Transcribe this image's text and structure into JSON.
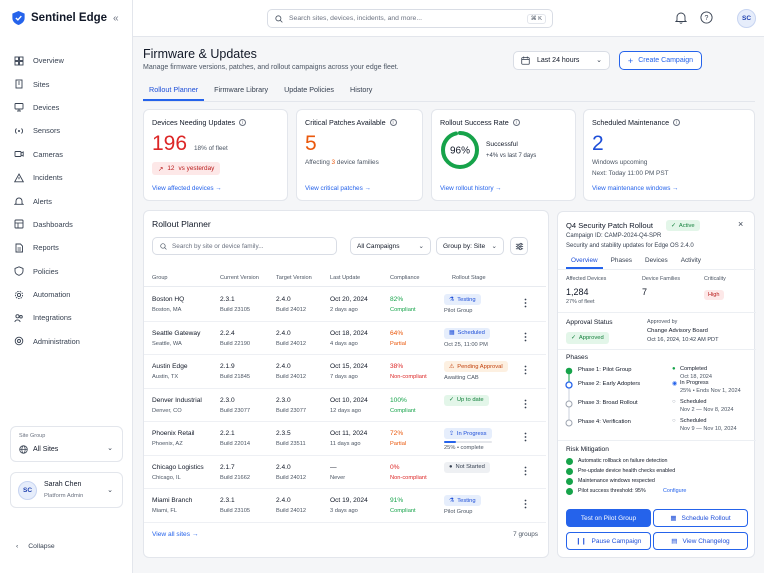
{
  "app": {
    "name": "Sentinel Edge"
  },
  "nav": [
    {
      "label": "Overview",
      "icon": "grid-icon"
    },
    {
      "label": "Sites",
      "icon": "building-icon"
    },
    {
      "label": "Devices",
      "icon": "monitor-icon"
    },
    {
      "label": "Sensors",
      "icon": "signal-icon"
    },
    {
      "label": "Cameras",
      "icon": "camera-icon"
    },
    {
      "label": "Incidents",
      "icon": "warning-icon"
    },
    {
      "label": "Alerts",
      "icon": "bell-icon"
    },
    {
      "label": "Dashboards",
      "icon": "dashboard-icon"
    },
    {
      "label": "Reports",
      "icon": "document-icon"
    },
    {
      "label": "Policies",
      "icon": "shield-icon"
    },
    {
      "label": "Automation",
      "icon": "gear-icon"
    },
    {
      "label": "Integrations",
      "icon": "people-icon"
    },
    {
      "label": "Administration",
      "icon": "settings-icon"
    }
  ],
  "site_group": {
    "label": "Site Group",
    "value": "All Sites"
  },
  "user": {
    "initials": "SC",
    "name": "Sarah Chen",
    "role": "Platform Admin"
  },
  "collapse_label": "Collapse",
  "search": {
    "placeholder": "Search sites, devices, incidents, and more...",
    "shortcut": "⌘ K"
  },
  "page": {
    "title": "Firmware & Updates",
    "subtitle": "Manage firmware versions, patches, and rollout campaigns across your edge fleet.",
    "range": "Last 24 hours",
    "create_label": "Create Campaign"
  },
  "tabs": [
    "Rollout Planner",
    "Firmware Library",
    "Update Policies",
    "History"
  ],
  "kpis": {
    "devices": {
      "title": "Devices Needing Updates",
      "value": "196",
      "pct": "18% of fleet",
      "delta": "12",
      "delta_label": "vs yesterday",
      "link": "View affected devices"
    },
    "patches": {
      "title": "Critical Patches Available",
      "value": "5",
      "desc_pre": "Affecting",
      "desc_num": "3",
      "desc_post": "device families",
      "link": "View critical patches"
    },
    "success": {
      "title": "Rollout Success Rate",
      "value": "96%",
      "progress": 0.96,
      "status": "Successful",
      "delta": "+4% vs last 7 days",
      "link": "View rollout history"
    },
    "maintenance": {
      "title": "Scheduled Maintenance",
      "value": "2",
      "desc": "Windows upcoming",
      "next": "Next: Today 11:00 PM PST",
      "link": "View maintenance windows"
    }
  },
  "planner": {
    "title": "Rollout Planner",
    "search_placeholder": "Search by site or device family...",
    "campaign_filter": "All Campaigns",
    "group_by": "Group by: Site",
    "columns": [
      "Group",
      "Current Version",
      "Target Version",
      "Last Update",
      "Compliance",
      "Rollout Stage"
    ],
    "rows": [
      {
        "name": "Boston HQ",
        "loc": "Boston, MA",
        "cur": "2.3.1",
        "cur_build": "Build 23105",
        "tgt": "2.4.0",
        "tgt_build": "Build 24012",
        "date": "Oct 20, 2024",
        "ago": "2 days ago",
        "comp": "82%",
        "comp_label": "Compliant",
        "comp_color": "#16a34a",
        "stage": "Testing",
        "stage_icon": "flask-icon",
        "stage_sub": "Pilot Group",
        "stage_bg": "#e6eefc",
        "stage_fg": "#1d4ed8",
        "progress": null
      },
      {
        "name": "Seattle Gateway",
        "loc": "Seattle, WA",
        "cur": "2.2.4",
        "cur_build": "Build 22190",
        "tgt": "2.4.0",
        "tgt_build": "Build 24012",
        "date": "Oct 18, 2024",
        "ago": "4 days ago",
        "comp": "64%",
        "comp_label": "Partial",
        "comp_color": "#ea580c",
        "stage": "Scheduled",
        "stage_icon": "calendar-icon",
        "stage_sub": "Oct 25, 11:00 PM",
        "stage_bg": "#e6eefc",
        "stage_fg": "#1d4ed8",
        "progress": null
      },
      {
        "name": "Austin Edge",
        "loc": "Austin, TX",
        "cur": "2.1.9",
        "cur_build": "Build 21845",
        "tgt": "2.4.0",
        "tgt_build": "Build 24012",
        "date": "Oct 15, 2024",
        "ago": "7 days ago",
        "comp": "38%",
        "comp_label": "Non-compliant",
        "comp_color": "#dc2626",
        "stage": "Pending Approval",
        "stage_icon": "warning-icon",
        "stage_sub": "Awaiting CAB",
        "stage_bg": "#fdf0e1",
        "stage_fg": "#c2410c",
        "progress": null
      },
      {
        "name": "Denver Industrial",
        "loc": "Denver, CO",
        "cur": "2.3.0",
        "cur_build": "Build 23077",
        "tgt": "2.3.0",
        "tgt_build": "Build 23077",
        "date": "Oct 10, 2024",
        "ago": "12 days ago",
        "comp": "100%",
        "comp_label": "Compliant",
        "comp_color": "#16a34a",
        "stage": "Up to date",
        "stage_icon": "check-circle-icon",
        "stage_sub": "",
        "stage_bg": "#e3f6e9",
        "stage_fg": "#15803d",
        "progress": null
      },
      {
        "name": "Phoenix Retail",
        "loc": "Phoenix, AZ",
        "cur": "2.2.1",
        "cur_build": "Build 22014",
        "tgt": "2.3.5",
        "tgt_build": "Build 23511",
        "date": "Oct 11, 2024",
        "ago": "11 days ago",
        "comp": "72%",
        "comp_label": "Partial",
        "comp_color": "#ea580c",
        "stage": "In Progress",
        "stage_icon": "upload-icon",
        "stage_sub": "25% • complete",
        "stage_bg": "#e6eefc",
        "stage_fg": "#1d4ed8",
        "progress": 0.25
      },
      {
        "name": "Chicago Logistics",
        "loc": "Chicago, IL",
        "cur": "2.1.7",
        "cur_build": "Build 21662",
        "tgt": "2.4.0",
        "tgt_build": "Build 24012",
        "date": "—",
        "ago": "Never",
        "comp": "0%",
        "comp_label": "Non-compliant",
        "comp_color": "#dc2626",
        "stage": "Not Started",
        "stage_icon": "dot-icon",
        "stage_sub": "",
        "stage_bg": "#eef0f3",
        "stage_fg": "#374151",
        "progress": null
      },
      {
        "name": "Miami Branch",
        "loc": "Miami, FL",
        "cur": "2.3.1",
        "cur_build": "Build 23105",
        "tgt": "2.4.0",
        "tgt_build": "Build 24012",
        "date": "Oct 19, 2024",
        "ago": "3 days ago",
        "comp": "91%",
        "comp_label": "Compliant",
        "comp_color": "#16a34a",
        "stage": "Testing",
        "stage_icon": "flask-icon",
        "stage_sub": "Pilot Group",
        "stage_bg": "#e6eefc",
        "stage_fg": "#1d4ed8",
        "progress": null
      }
    ],
    "view_all": "View all sites",
    "count": "7 groups"
  },
  "detail": {
    "title": "Q4 Security Patch Rollout",
    "status": "Active",
    "campaign_id": "Campaign ID: CAMP-2024-Q4-SPR",
    "desc": "Security and stability updates for Edge OS 2.4.0",
    "tabs": [
      "Overview",
      "Phases",
      "Devices",
      "Activity"
    ],
    "affected_label": "Affected Devices",
    "affected_value": "1,284",
    "affected_pct": "27% of fleet",
    "families_label": "Device Families",
    "families_value": "7",
    "criticality_label": "Criticality",
    "criticality_value": "High",
    "approval_label": "Approval Status",
    "approval_value": "Approved",
    "approved_by_label": "Approved by",
    "approved_by": "Change Advisory Board",
    "approved_at": "Oct 16, 2024, 10:42 AM PDT",
    "phases_title": "Phases",
    "phases": [
      {
        "name": "Phase 1: Pilot Group",
        "status": "Completed",
        "date": "Oct 18, 2024",
        "state": "done"
      },
      {
        "name": "Phase 2: Early Adopters",
        "status": "In Progress",
        "date": "25% • Ends Nov 1, 2024",
        "state": "active"
      },
      {
        "name": "Phase 3: Broad Rollout",
        "status": "Scheduled",
        "date": "Nov 2 — Nov 8, 2024",
        "state": "pending"
      },
      {
        "name": "Phase 4: Verification",
        "status": "Scheduled",
        "date": "Nov 9 — Nov 10, 2024",
        "state": "pending"
      }
    ],
    "risk_title": "Risk Mitigation",
    "risks": [
      "Automatic rollback on failure detection",
      "Pre-update device health checks enabled",
      "Maintenance windows respected",
      "Pilot success threshold: 95%"
    ],
    "configure": "Configure",
    "buttons": {
      "test": "Test on Pilot Group",
      "schedule": "Schedule Rollout",
      "pause": "Pause Campaign",
      "changelog": "View Changelog"
    }
  }
}
